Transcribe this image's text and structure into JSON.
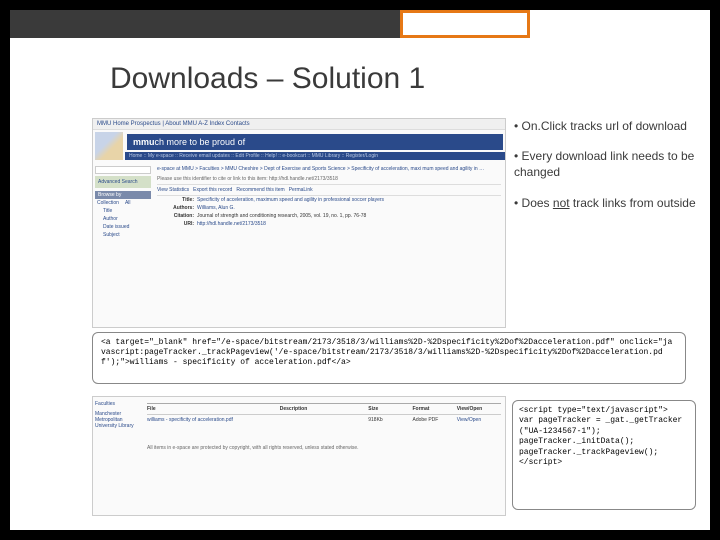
{
  "slide": {
    "title": "Downloads – Solution 1"
  },
  "bullets": [
    {
      "prefix": "• On.Click ",
      "underlined": "",
      "rest": "tracks url of download",
      "text": "• On.Click tracks url of download"
    },
    {
      "prefix": "• Every download link needs to be changed",
      "underlined": "",
      "rest": ""
    },
    {
      "prefix": "• Does ",
      "underlined": "not",
      "rest": " track links from outside"
    }
  ],
  "code1": "<a target=\"_blank\" href=\"/e-space/bitstream/2173/3518/3/williams%2D-%2Dspecificity%2Dof%2Dacceleration.pdf\" onclick=\"javascript:pageTracker._trackPageview('/e-space/bitstream/2173/3518/3/williams%2D-%2Dspecificity%2Dof%2Dacceleration.pdf');\">williams - specificity of acceleration.pdf</a>",
  "code2": "<script type=\"text/javascript\">\nvar pageTracker = _gat._getTracker(\"UA-1234567-1\");\npageTracker._initData();\npageTracker._trackPageview();\n</script>",
  "screenshot": {
    "topnav": "MMU Home  Prospectus | About MMU  A-Z Index  Contacts",
    "banner_prefix": "mmu",
    "banner_rest": "ch more to be proud of",
    "subnav": "Home  ::  My e-space  ::  Receive email updates  ::  Edit Profile  ::  Help!  ::  e-bookcart  ::  MMU Library  ::  Register/Login",
    "crumb": "e-space at MMU > Faculties > MMU Cheshire > Dept of Exercise and Sports Science > Specificity of acceleration, maxi mum speed and agility in …",
    "url_label": "Please use this identifier to cite or link to this item:",
    "url": "http://hdl.handle.net/2173/3518",
    "search_title": "Advanced Search",
    "browse_title": "Browse by",
    "tabs": {
      "a": "Collection",
      "b": "All"
    },
    "tree": [
      "Title",
      "Author",
      "Date issued",
      "Subject"
    ],
    "toolbar": [
      "View Statistics",
      "Export this record",
      "Recommend this item",
      "PermaLink"
    ],
    "meta": {
      "title_label": "Title:",
      "title_val": "Specificity of acceleration, maximum speed and agility in professional soccer players",
      "authors_label": "Authors:",
      "authors_val": "Williams, Alun G.",
      "citation_label": "Citation:",
      "citation_val": "Journal of strength and conditioning research, 2005, vol. 19, no. 1, pp. 76-78",
      "uri_label": "URI:",
      "uri_val": "http://hdl.handle.net/2173/3518"
    }
  },
  "screenshot2": {
    "sidebar": [
      "Faculties",
      "Manchester Metropolitan University Library"
    ],
    "table": {
      "headers": {
        "file": "File",
        "desc": "Description",
        "size": "Size",
        "fmt": "Format",
        "view": "View/Open"
      },
      "row": {
        "file": "williams - specificity of acceleration.pdf",
        "desc": "",
        "size": "918Kb",
        "fmt": "Adobe PDF",
        "view": "View/Open"
      }
    },
    "footer": "All items in e-space are protected by copyright, with all rights reserved, unless stated otherwise."
  }
}
